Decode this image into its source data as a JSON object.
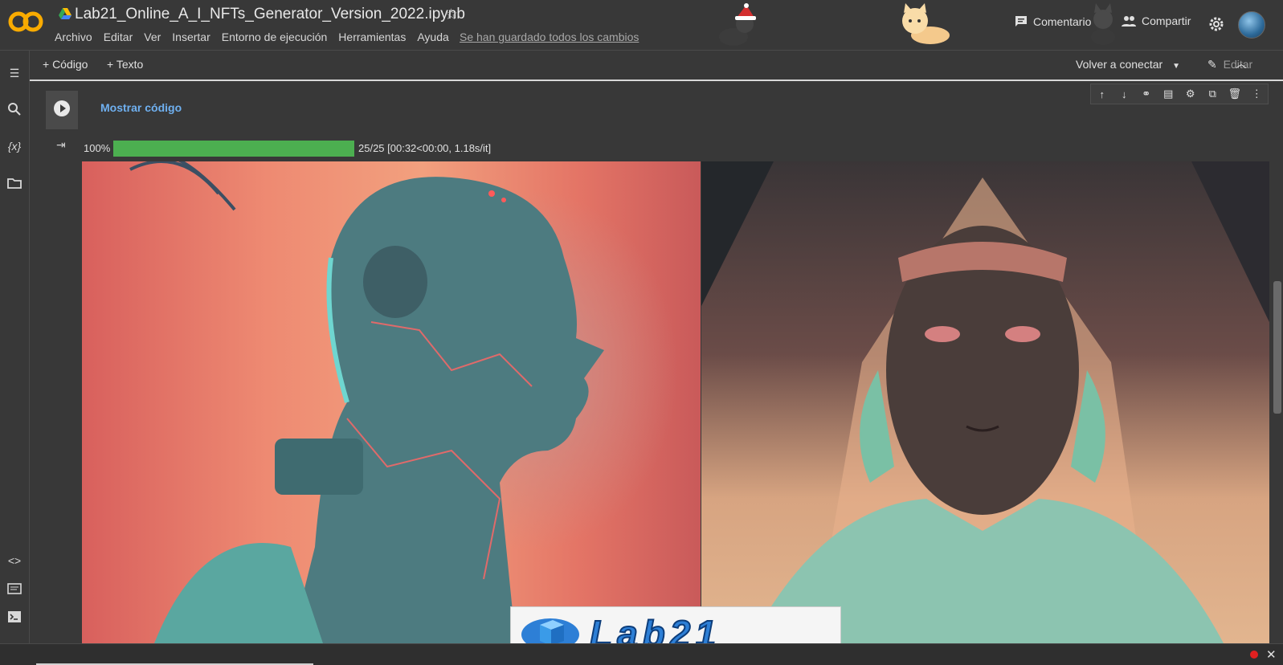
{
  "header": {
    "logo_text": "CO",
    "notebook_title": "Lab21_Online_A_I_NFTs_Generator_Version_2022.ipynb",
    "menu": [
      "Archivo",
      "Editar",
      "Ver",
      "Insertar",
      "Entorno de ejecución",
      "Herramientas",
      "Ayuda"
    ],
    "saved_status": "Se han guardado todos los cambios",
    "comment_label": "Comentario",
    "share_label": "Compartir"
  },
  "toolbar": {
    "add_code_label": "+ Código",
    "add_text_label": "+ Texto",
    "connect_label": "Volver a conectar",
    "edit_label": "Editar"
  },
  "cell": {
    "show_code_label": "Mostrar código",
    "progress": {
      "percent_text": "100%",
      "fraction": 1.0,
      "detail_text": "25/25 [00:32<00:00, 1.18s/it]"
    }
  },
  "watermark": {
    "text": "Lab21"
  },
  "colors": {
    "accent": "#6fb0f0",
    "progress": "#4caf50",
    "logo_orange": "#f9ab00"
  }
}
